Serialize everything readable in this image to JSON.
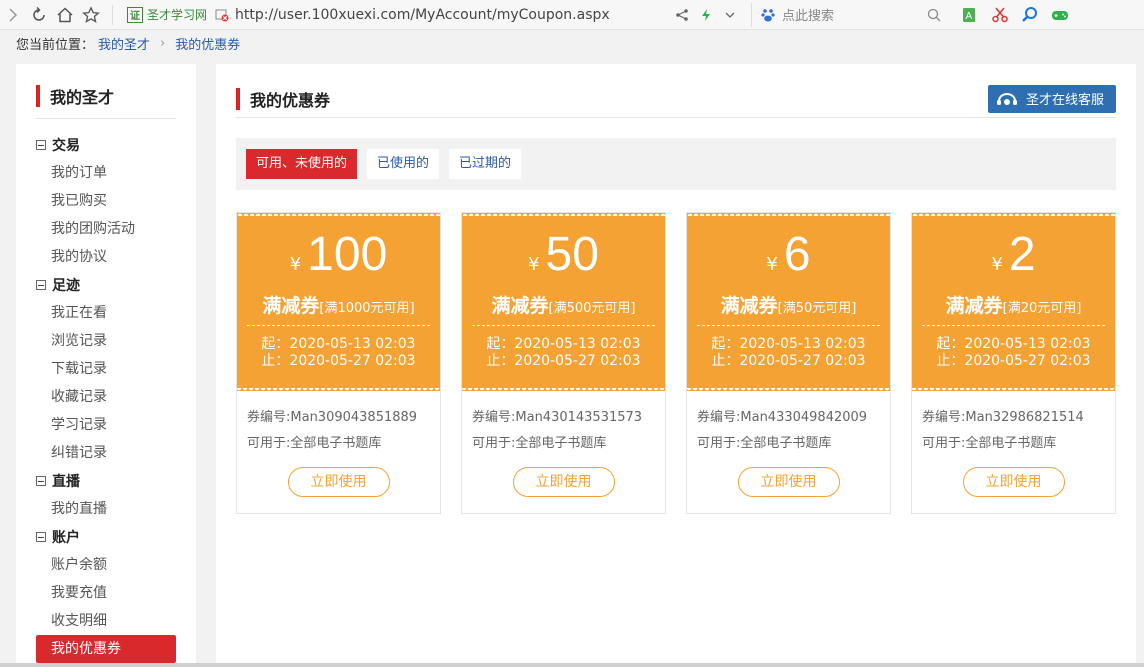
{
  "browser": {
    "site_name": "圣才学习网",
    "site_logo_text": "证",
    "url": "http://user.100xuexi.com/MyAccount/myCoupon.aspx",
    "search_placeholder": "点此搜索"
  },
  "breadcrumb": {
    "prefix": "您当前位置：",
    "items": [
      "我的圣才",
      "我的优惠券"
    ]
  },
  "sidebar": {
    "title": "我的圣才",
    "groups": [
      {
        "label": "交易",
        "items": [
          "我的订单",
          "我已购买",
          "我的团购活动",
          "我的协议"
        ]
      },
      {
        "label": "足迹",
        "items": [
          "我正在看",
          "浏览记录",
          "下载记录",
          "收藏记录",
          "学习记录",
          "纠错记录"
        ]
      },
      {
        "label": "直播",
        "items": [
          "我的直播"
        ]
      },
      {
        "label": "账户",
        "items": [
          "账户余额",
          "我要充值",
          "收支明细",
          "我的优惠券"
        ]
      }
    ],
    "active_item": "我的优惠券"
  },
  "main": {
    "title": "我的优惠券",
    "service_button": "圣才在线客服",
    "tabs": [
      "可用、未使用的",
      "已使用的",
      "已过期的"
    ],
    "active_tab": 0,
    "coupons": [
      {
        "currency": "¥",
        "amount": "100",
        "type": "满减券",
        "condition": "[满1000元可用]",
        "start": "起：2020-05-13 02:03",
        "end": "止：2020-05-27 02:03",
        "code": "券编号:Man309043851889",
        "scope": "可用于:全部电子书题库",
        "button": "立即使用"
      },
      {
        "currency": "¥",
        "amount": "50",
        "type": "满减券",
        "condition": "[满500元可用]",
        "start": "起：2020-05-13 02:03",
        "end": "止：2020-05-27 02:03",
        "code": "券编号:Man430143531573",
        "scope": "可用于:全部电子书题库",
        "button": "立即使用"
      },
      {
        "currency": "¥",
        "amount": "6",
        "type": "满减券",
        "condition": "[满50元可用]",
        "start": "起：2020-05-13 02:03",
        "end": "止：2020-05-27 02:03",
        "code": "券编号:Man433049842009",
        "scope": "可用于:全部电子书题库",
        "button": "立即使用"
      },
      {
        "currency": "¥",
        "amount": "2",
        "type": "满减券",
        "condition": "[满20元可用]",
        "start": "起：2020-05-13 02:03",
        "end": "止：2020-05-27 02:03",
        "code": "券编号:Man32986821514",
        "scope": "可用于:全部电子书题库",
        "button": "立即使用"
      }
    ]
  },
  "colors": {
    "accent_red": "#d9292c",
    "coupon_orange": "#f5a234",
    "service_blue": "#2d6fb0",
    "link_blue": "#2a5aa8"
  }
}
